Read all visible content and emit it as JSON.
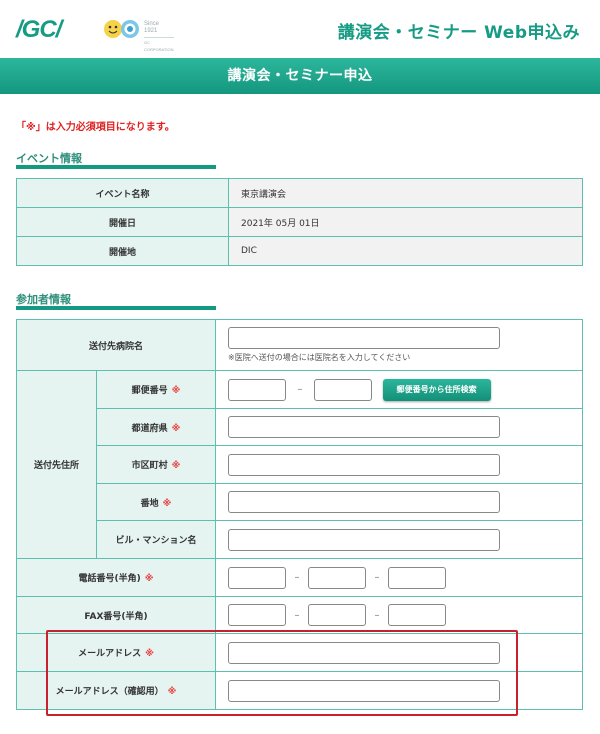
{
  "header": {
    "logo_text": "/GC/",
    "since_text": "Since 1921",
    "since_sub": "GC CORPORATION",
    "title": "講演会・セミナー Web申込み"
  },
  "page_title": "講演会・セミナー申込",
  "notice": "「※」は入力必須項目になります。",
  "event_section": {
    "heading": "イベント情報",
    "rows": [
      {
        "label": "イベント名称",
        "value": "東京講演会"
      },
      {
        "label": "開催日",
        "value": "2021年 05月 01日"
      },
      {
        "label": "開催地",
        "value": "DIC"
      }
    ]
  },
  "participant_section": {
    "heading": "参加者情報",
    "hospital_label": "送付先病院名",
    "hospital_hint": "※医院へ送付の場合には医院名を入力してください",
    "address_group_label": "送付先住所",
    "postal_label": "郵便番号",
    "postal_search_button": "郵便番号から住所検索",
    "prefecture_label": "都道府県",
    "city_label": "市区町村",
    "street_label": "番地",
    "building_label": "ビル・マンション名",
    "phone_label": "電話番号(半角)",
    "fax_label": "FAX番号(半角)",
    "email_label": "メールアドレス",
    "email_confirm_label": "メールアドレス（確認用）",
    "required_mark": "※",
    "separator": "–"
  },
  "colors": {
    "brand_green": "#169b84",
    "label_bg": "#e6f4f1",
    "required_red": "#e73a3a",
    "highlight_red": "#c8202c"
  }
}
